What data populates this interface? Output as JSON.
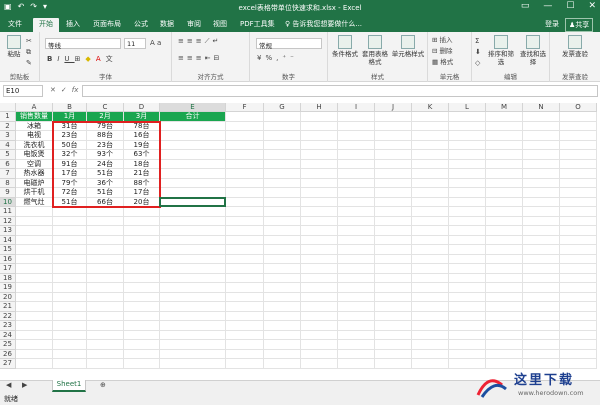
{
  "window": {
    "title": "excel表格带单位快速求和.xlsx - Excel",
    "qat_icons": [
      "save-icon",
      "undo-icon",
      "redo-icon",
      "customize-qat-icon"
    ],
    "win_controls": [
      "ribbon-display-icon",
      "minimize-icon",
      "maximize-icon",
      "close-icon"
    ]
  },
  "tabs": [
    "文件",
    "开始",
    "插入",
    "页面布局",
    "公式",
    "数据",
    "审阅",
    "视图",
    "PDF工具集"
  ],
  "active_tab": "开始",
  "tell_me": "告诉我您想要做什么...",
  "login": "登录",
  "share": "共享",
  "ribbon": {
    "clipboard": {
      "label": "剪贴板",
      "paste": "粘贴"
    },
    "font": {
      "label": "字体",
      "name": "等线",
      "size": "11"
    },
    "alignment": {
      "label": "对齐方式"
    },
    "number": {
      "label": "数字",
      "format": "常规"
    },
    "styles": {
      "label": "样式",
      "cond": "条件格式",
      "table": "套用表格格式",
      "cell": "单元格样式"
    },
    "cells": {
      "label": "单元格",
      "insert": "插入",
      "delete": "删除",
      "format": "格式"
    },
    "editing": {
      "label": "编辑",
      "sort": "排序和筛选",
      "find": "查找和选择"
    },
    "invoice": {
      "label": "发票查验",
      "check": "发票查验"
    }
  },
  "formula": {
    "name_box": "E10",
    "value": ""
  },
  "columns": [
    "A",
    "B",
    "C",
    "D",
    "E",
    "F",
    "G",
    "H",
    "I",
    "J",
    "K",
    "L",
    "M",
    "N",
    "O"
  ],
  "header_row": [
    "销售数量",
    "1月",
    "2月",
    "3月",
    "合计"
  ],
  "rows": [
    [
      "冰箱",
      "31台",
      "79台",
      "78台",
      ""
    ],
    [
      "电视",
      "23台",
      "88台",
      "16台",
      ""
    ],
    [
      "洗衣机",
      "50台",
      "23台",
      "19台",
      ""
    ],
    [
      "电饭煲",
      "32个",
      "93个",
      "63个",
      ""
    ],
    [
      "空调",
      "91台",
      "24台",
      "18台",
      ""
    ],
    [
      "热水器",
      "17台",
      "51台",
      "21台",
      ""
    ],
    [
      "电磁炉",
      "79个",
      "36个",
      "88个",
      ""
    ],
    [
      "烘干机",
      "72台",
      "51台",
      "17台",
      ""
    ],
    [
      "燃气灶",
      "51台",
      "66台",
      "20台",
      ""
    ]
  ],
  "row_count": 27,
  "sheet_tab": "Sheet1",
  "status": "就绪",
  "colors": {
    "accent": "#217346",
    "header_fill": "#1aa650",
    "highlight": "#e02020"
  },
  "watermark": {
    "text": "这里下载",
    "url": "www.herodown.com"
  }
}
